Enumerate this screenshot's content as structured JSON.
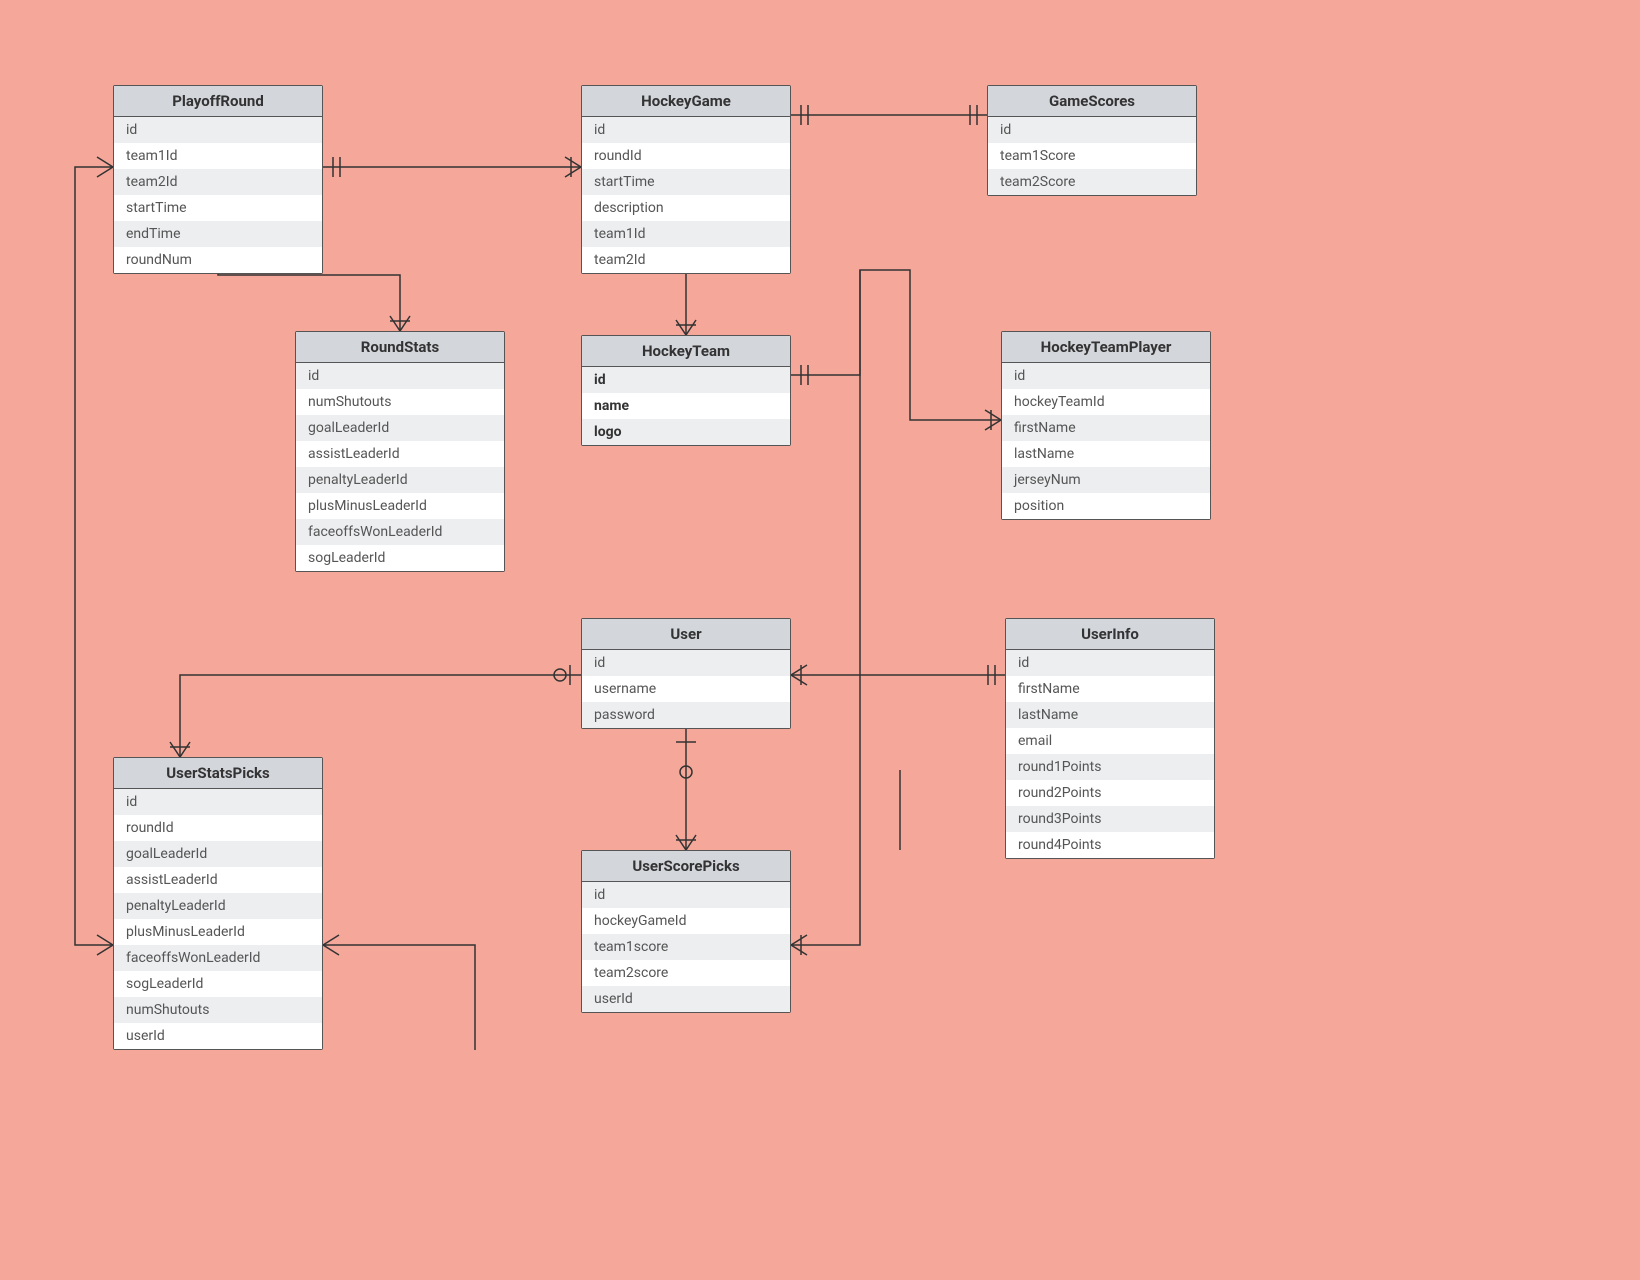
{
  "entities": {
    "playoffRound": {
      "title": "PlayoffRound",
      "fields": [
        "id",
        "team1Id",
        "team2Id",
        "startTime",
        "endTime",
        "roundNum"
      ]
    },
    "hockeyGame": {
      "title": "HockeyGame",
      "fields": [
        "id",
        "roundId",
        "startTime",
        "description",
        "team1Id",
        "team2Id"
      ]
    },
    "gameScores": {
      "title": "GameScores",
      "fields": [
        "id",
        "team1Score",
        "team2Score"
      ]
    },
    "roundStats": {
      "title": "RoundStats",
      "fields": [
        "id",
        "numShutouts",
        "goalLeaderId",
        "assistLeaderId",
        "penaltyLeaderId",
        "plusMinusLeaderId",
        "faceoffsWonLeaderId",
        "sogLeaderId"
      ]
    },
    "hockeyTeam": {
      "title": "HockeyTeam",
      "fields": [
        "id",
        "name",
        "logo"
      ],
      "bold": true
    },
    "hockeyTeamPlayer": {
      "title": "HockeyTeamPlayer",
      "fields": [
        "id",
        "hockeyTeamId",
        "firstName",
        "lastName",
        "jerseyNum",
        "position"
      ]
    },
    "user": {
      "title": "User",
      "fields": [
        "id",
        "username",
        "password"
      ]
    },
    "userInfo": {
      "title": "UserInfo",
      "fields": [
        "id",
        "firstName",
        "lastName",
        "email",
        "round1Points",
        "round2Points",
        "round3Points",
        "round4Points"
      ]
    },
    "userStatsPicks": {
      "title": "UserStatsPicks",
      "fields": [
        "id",
        "roundId",
        "goalLeaderId",
        "assistLeaderId",
        "penaltyLeaderId",
        "plusMinusLeaderId",
        "faceoffsWonLeaderId",
        "sogLeaderId",
        "numShutouts",
        "userId"
      ]
    },
    "userScorePicks": {
      "title": "UserScorePicks",
      "fields": [
        "id",
        "hockeyGameId",
        "team1score",
        "team2score",
        "userId"
      ]
    }
  }
}
